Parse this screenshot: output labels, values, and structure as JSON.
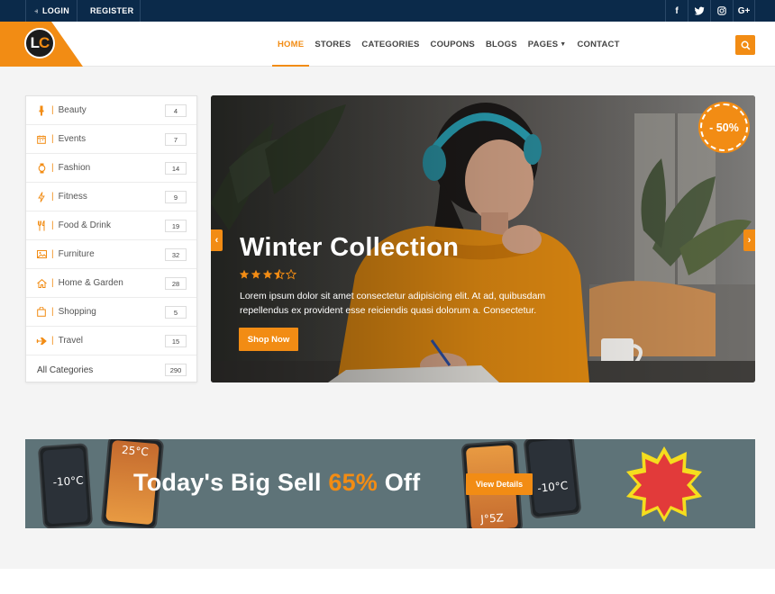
{
  "topbar": {
    "login_label": "LOGIN",
    "register_label": "REGISTER",
    "social": [
      {
        "icon": "facebook-icon",
        "glyph": "f"
      },
      {
        "icon": "twitter-icon",
        "glyph": "t"
      },
      {
        "icon": "instagram-icon",
        "glyph": "◎"
      },
      {
        "icon": "google-plus-icon",
        "glyph": "G+"
      }
    ]
  },
  "logo": {
    "text_primary": "L",
    "text_secondary": "C"
  },
  "nav": {
    "items": [
      {
        "label": "HOME",
        "active": true
      },
      {
        "label": "STORES"
      },
      {
        "label": "CATEGORIES"
      },
      {
        "label": "COUPONS"
      },
      {
        "label": "BLOGS"
      },
      {
        "label": "PAGES",
        "dropdown": true
      },
      {
        "label": "CONTACT"
      }
    ]
  },
  "sidebar": {
    "categories": [
      {
        "label": "Beauty",
        "count": "4",
        "icon": "lipstick-icon"
      },
      {
        "label": "Events",
        "count": "7",
        "icon": "calendar-icon"
      },
      {
        "label": "Fashion",
        "count": "14",
        "icon": "watch-icon"
      },
      {
        "label": "Fitness",
        "count": "9",
        "icon": "lightning-icon"
      },
      {
        "label": "Food & Drink",
        "count": "19",
        "icon": "utensils-icon"
      },
      {
        "label": "Furniture",
        "count": "32",
        "icon": "image-icon"
      },
      {
        "label": "Home & Garden",
        "count": "28",
        "icon": "home-icon"
      },
      {
        "label": "Shopping",
        "count": "5",
        "icon": "shopping-bag-icon"
      },
      {
        "label": "Travel",
        "count": "15",
        "icon": "plane-icon"
      }
    ],
    "all": {
      "label": "All Categories",
      "count": "290"
    }
  },
  "hero": {
    "title": "Winter Collection",
    "rating": 3.5,
    "description": "Lorem ipsum dolor sit amet consectetur adipisicing elit. At ad, quibusdam repellendus ex provident esse reiciendis quasi dolorum a. Consectetur.",
    "button_label": "Shop Now",
    "badge": "- 50%"
  },
  "banner": {
    "text_before": "Today's Big Sell ",
    "highlight": "65%",
    "text_after": " Off",
    "button_label": "View Details",
    "phone_labels": [
      "25°C",
      "-10°C",
      "-10°C",
      "J°5Z"
    ]
  },
  "colors": {
    "accent": "#f28c14",
    "topbar": "#0b2a4a",
    "banner_bg": "#5e7378"
  }
}
